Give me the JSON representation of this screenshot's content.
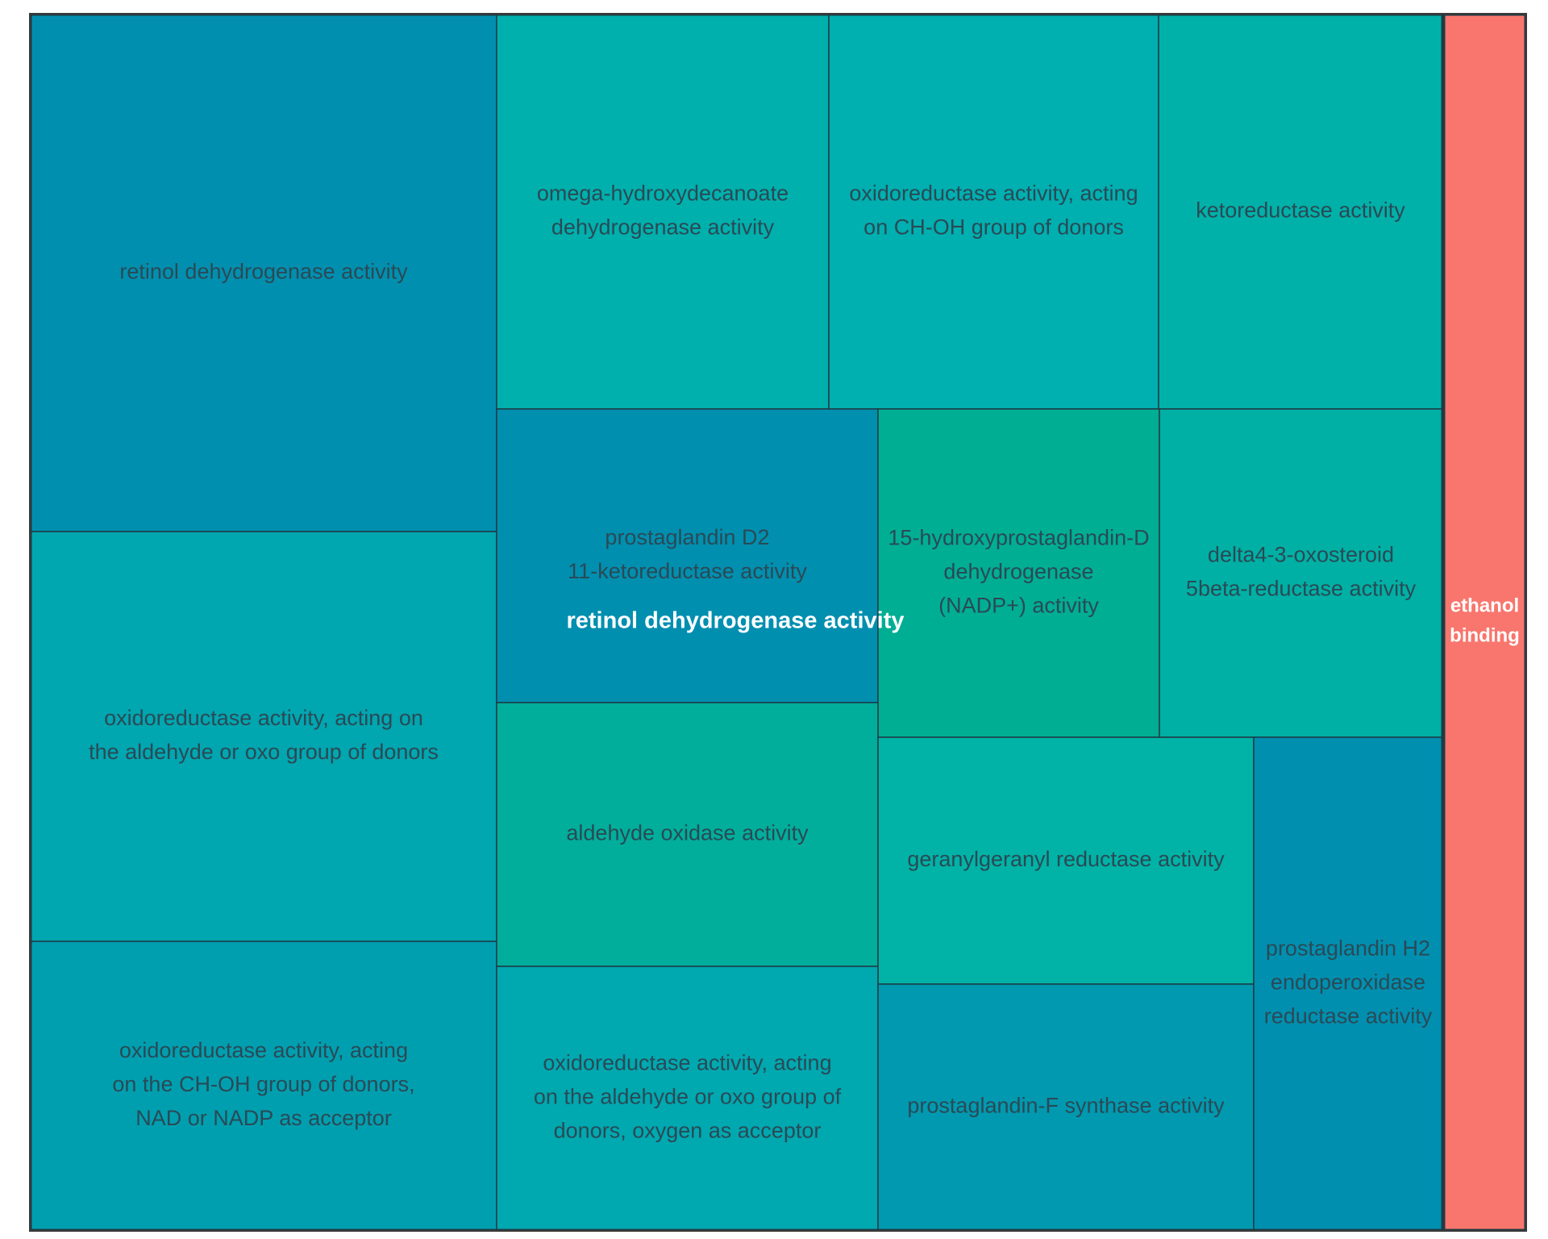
{
  "chart_data": {
    "type": "treemap",
    "groups": [
      {
        "name": "retinol dehydrogenase activity",
        "color": "#00b4a5",
        "tiles": [
          {
            "name": "retinol dehydrogenase activity",
            "label_lines": [
              "retinol dehydrogenase activity"
            ],
            "color": "#018fb0"
          },
          {
            "name": "oxidoreductase activity, acting on the aldehyde or oxo group of donors",
            "label_lines": [
              "oxidoreductase activity, acting on",
              "the aldehyde or oxo group of donors"
            ],
            "color": "#00a6b0"
          },
          {
            "name": "oxidoreductase activity, acting on the CH-OH group of donors, NAD or NADP as acceptor",
            "label_lines": [
              "oxidoreductase activity, acting",
              "on the CH-OH group of donors,",
              "NAD or NADP as acceptor"
            ],
            "color": "#009fb0"
          },
          {
            "name": "omega-hydroxydecanoate dehydrogenase activity",
            "label_lines": [
              "omega-hydroxydecanoate",
              "dehydrogenase activity"
            ],
            "color": "#00b0ad"
          },
          {
            "name": "oxidoreductase activity, acting on CH-OH group of donors",
            "label_lines": [
              "oxidoreductase activity, acting",
              "on CH-OH group of donors"
            ],
            "color": "#00afb0"
          },
          {
            "name": "ketoreductase activity",
            "label_lines": [
              "ketoreductase activity"
            ],
            "color": "#00b1a9"
          },
          {
            "name": "prostaglandin D2 11-ketoreductase activity",
            "label_lines": [
              "prostaglandin D2",
              "11-ketoreductase activity"
            ],
            "color": "#018fb0"
          },
          {
            "name": "15-hydroxyprostaglandin-D dehydrogenase (NADP+) activity",
            "label_lines": [
              "15-hydroxyprostaglandin-D",
              "dehydrogenase",
              "(NADP+) activity"
            ],
            "color": "#00ae94"
          },
          {
            "name": "delta4-3-oxosteroid 5beta-reductase activity",
            "label_lines": [
              "delta4-3-oxosteroid",
              "5beta-reductase activity"
            ],
            "color": "#00b0a5"
          },
          {
            "name": "aldehyde oxidase activity",
            "label_lines": [
              "aldehyde oxidase activity"
            ],
            "color": "#00ae9b"
          },
          {
            "name": "geranylgeranyl reductase activity",
            "label_lines": [
              "geranylgeranyl reductase activity"
            ],
            "color": "#00b3a6"
          },
          {
            "name": "oxidoreductase activity, acting on the aldehyde or oxo group of donors, oxygen as acceptor",
            "label_lines": [
              "oxidoreductase activity, acting",
              "on the aldehyde or oxo group of",
              "donors, oxygen as acceptor"
            ],
            "color": "#00a8b0"
          },
          {
            "name": "prostaglandin-F synthase activity",
            "label_lines": [
              "prostaglandin-F synthase activity"
            ],
            "color": "#0099b0"
          },
          {
            "name": "prostaglandin H2 endoperoxidase reductase activity",
            "label_lines": [
              "prostaglandin H2",
              "endoperoxidase",
              "reductase activity"
            ],
            "color": "#018fb0"
          }
        ]
      },
      {
        "name": "ethanol binding",
        "label_lines": [
          "ethanol",
          "binding"
        ],
        "color": "#f8766d",
        "tiles": []
      }
    ]
  }
}
